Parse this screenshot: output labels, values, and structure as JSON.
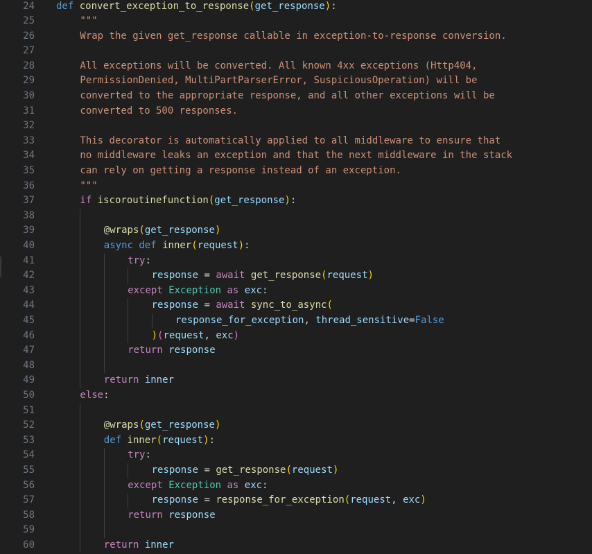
{
  "editor": {
    "theme_colors": {
      "background": "#1f1f1f",
      "line_number": "#6e7681",
      "keyword": "#569cd6",
      "control": "#c586c0",
      "function": "#dcdcaa",
      "variable": "#9cdcfe",
      "class": "#4ec9b0",
      "string": "#ce9178",
      "bracket_1": "#ffd700",
      "bracket_2": "#da70d6",
      "bracket_3": "#179fff"
    },
    "lines": [
      {
        "n": "24",
        "indent": 0,
        "tokens": [
          [
            "kw",
            "def "
          ],
          [
            "fn",
            "convert_exception_to_response"
          ],
          [
            "b1",
            "("
          ],
          [
            "var",
            "get_response"
          ],
          [
            "b1",
            ")"
          ],
          [
            "punc",
            ":"
          ]
        ]
      },
      {
        "n": "25",
        "indent": 1,
        "tokens": [
          [
            "str",
            "\"\"\""
          ]
        ]
      },
      {
        "n": "26",
        "indent": 1,
        "tokens": [
          [
            "str",
            "Wrap the given get_response callable in exception-to-response conversion."
          ]
        ]
      },
      {
        "n": "27",
        "indent": 0,
        "tokens": []
      },
      {
        "n": "28",
        "indent": 1,
        "tokens": [
          [
            "str",
            "All exceptions will be converted. All known 4xx exceptions (Http404,"
          ]
        ]
      },
      {
        "n": "29",
        "indent": 1,
        "tokens": [
          [
            "str",
            "PermissionDenied, MultiPartParserError, SuspiciousOperation) will be"
          ]
        ]
      },
      {
        "n": "30",
        "indent": 1,
        "tokens": [
          [
            "str",
            "converted to the appropriate response, and all other exceptions will be"
          ]
        ]
      },
      {
        "n": "31",
        "indent": 1,
        "tokens": [
          [
            "str",
            "converted to 500 responses."
          ]
        ]
      },
      {
        "n": "32",
        "indent": 0,
        "tokens": []
      },
      {
        "n": "33",
        "indent": 1,
        "tokens": [
          [
            "str",
            "This decorator is automatically applied to all middleware to ensure that"
          ]
        ]
      },
      {
        "n": "34",
        "indent": 1,
        "tokens": [
          [
            "str",
            "no middleware leaks an exception and that the next middleware in the stack"
          ]
        ]
      },
      {
        "n": "35",
        "indent": 1,
        "tokens": [
          [
            "str",
            "can rely on getting a response instead of an exception."
          ]
        ]
      },
      {
        "n": "36",
        "indent": 1,
        "tokens": [
          [
            "str",
            "\"\"\""
          ]
        ]
      },
      {
        "n": "37",
        "indent": 1,
        "tokens": [
          [
            "ctl",
            "if "
          ],
          [
            "fn",
            "iscoroutinefunction"
          ],
          [
            "b1",
            "("
          ],
          [
            "var",
            "get_response"
          ],
          [
            "b1",
            ")"
          ],
          [
            "punc",
            ":"
          ]
        ]
      },
      {
        "n": "38",
        "indent": 0,
        "guides": [
          1
        ],
        "tokens": []
      },
      {
        "n": "39",
        "indent": 2,
        "tokens": [
          [
            "fn",
            "@wraps"
          ],
          [
            "b1",
            "("
          ],
          [
            "var",
            "get_response"
          ],
          [
            "b1",
            ")"
          ]
        ]
      },
      {
        "n": "40",
        "indent": 2,
        "tokens": [
          [
            "kw",
            "async def "
          ],
          [
            "fn",
            "inner"
          ],
          [
            "b1",
            "("
          ],
          [
            "var",
            "request"
          ],
          [
            "b1",
            ")"
          ],
          [
            "punc",
            ":"
          ]
        ]
      },
      {
        "n": "41",
        "indent": 3,
        "tokens": [
          [
            "ctl",
            "try"
          ],
          [
            "punc",
            ":"
          ]
        ]
      },
      {
        "n": "42",
        "indent": 4,
        "tokens": [
          [
            "var",
            "response"
          ],
          [
            "op",
            " = "
          ],
          [
            "ctl",
            "await "
          ],
          [
            "fn",
            "get_response"
          ],
          [
            "b1",
            "("
          ],
          [
            "var",
            "request"
          ],
          [
            "b1",
            ")"
          ]
        ]
      },
      {
        "n": "43",
        "indent": 3,
        "tokens": [
          [
            "ctl",
            "except "
          ],
          [
            "cls",
            "Exception"
          ],
          [
            "ctl",
            " as "
          ],
          [
            "var",
            "exc"
          ],
          [
            "punc",
            ":"
          ]
        ]
      },
      {
        "n": "44",
        "indent": 4,
        "tokens": [
          [
            "var",
            "response"
          ],
          [
            "op",
            " = "
          ],
          [
            "ctl",
            "await "
          ],
          [
            "fn",
            "sync_to_async"
          ],
          [
            "b1",
            "("
          ]
        ]
      },
      {
        "n": "45",
        "indent": 5,
        "tokens": [
          [
            "var",
            "response_for_exception"
          ],
          [
            "punc",
            ", "
          ],
          [
            "var",
            "thread_sensitive"
          ],
          [
            "op",
            "="
          ],
          [
            "const",
            "False"
          ]
        ]
      },
      {
        "n": "46",
        "indent": 4,
        "tokens": [
          [
            "b1",
            ")"
          ],
          [
            "b2",
            "("
          ],
          [
            "var",
            "request"
          ],
          [
            "punc",
            ", "
          ],
          [
            "var",
            "exc"
          ],
          [
            "b2",
            ")"
          ]
        ]
      },
      {
        "n": "47",
        "indent": 3,
        "tokens": [
          [
            "ctl",
            "return "
          ],
          [
            "var",
            "response"
          ]
        ]
      },
      {
        "n": "48",
        "indent": 0,
        "guides": [
          1,
          2
        ],
        "tokens": []
      },
      {
        "n": "49",
        "indent": 2,
        "tokens": [
          [
            "ctl",
            "return "
          ],
          [
            "var",
            "inner"
          ]
        ]
      },
      {
        "n": "50",
        "indent": 1,
        "tokens": [
          [
            "ctl",
            "else"
          ],
          [
            "punc",
            ":"
          ]
        ]
      },
      {
        "n": "51",
        "indent": 0,
        "guides": [
          1
        ],
        "tokens": []
      },
      {
        "n": "52",
        "indent": 2,
        "tokens": [
          [
            "fn",
            "@wraps"
          ],
          [
            "b1",
            "("
          ],
          [
            "var",
            "get_response"
          ],
          [
            "b1",
            ")"
          ]
        ]
      },
      {
        "n": "53",
        "indent": 2,
        "tokens": [
          [
            "kw",
            "def "
          ],
          [
            "fn",
            "inner"
          ],
          [
            "b1",
            "("
          ],
          [
            "var",
            "request"
          ],
          [
            "b1",
            ")"
          ],
          [
            "punc",
            ":"
          ]
        ]
      },
      {
        "n": "54",
        "indent": 3,
        "tokens": [
          [
            "ctl",
            "try"
          ],
          [
            "punc",
            ":"
          ]
        ]
      },
      {
        "n": "55",
        "indent": 4,
        "tokens": [
          [
            "var",
            "response"
          ],
          [
            "op",
            " = "
          ],
          [
            "fn",
            "get_response"
          ],
          [
            "b1",
            "("
          ],
          [
            "var",
            "request"
          ],
          [
            "b1",
            ")"
          ]
        ]
      },
      {
        "n": "56",
        "indent": 3,
        "tokens": [
          [
            "ctl",
            "except "
          ],
          [
            "cls",
            "Exception"
          ],
          [
            "ctl",
            " as "
          ],
          [
            "var",
            "exc"
          ],
          [
            "punc",
            ":"
          ]
        ]
      },
      {
        "n": "57",
        "indent": 4,
        "tokens": [
          [
            "var",
            "response"
          ],
          [
            "op",
            " = "
          ],
          [
            "fn",
            "response_for_exception"
          ],
          [
            "b1",
            "("
          ],
          [
            "var",
            "request"
          ],
          [
            "punc",
            ", "
          ],
          [
            "var",
            "exc"
          ],
          [
            "b1",
            ")"
          ]
        ]
      },
      {
        "n": "58",
        "indent": 3,
        "tokens": [
          [
            "ctl",
            "return "
          ],
          [
            "var",
            "response"
          ]
        ]
      },
      {
        "n": "59",
        "indent": 0,
        "guides": [
          1,
          2
        ],
        "tokens": []
      },
      {
        "n": "60",
        "indent": 2,
        "tokens": [
          [
            "ctl",
            "return "
          ],
          [
            "var",
            "inner"
          ]
        ]
      }
    ]
  }
}
